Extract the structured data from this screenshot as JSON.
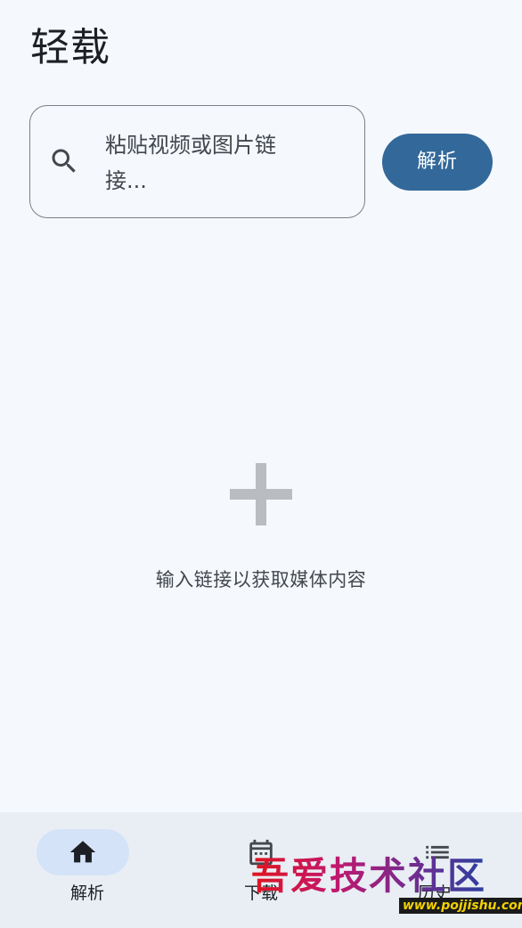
{
  "header": {
    "title": "轻载"
  },
  "search": {
    "placeholder": "粘贴视频或图片链接...",
    "icon": "search-icon"
  },
  "actions": {
    "parse_label": "解析"
  },
  "empty_state": {
    "icon": "add-icon",
    "message": "输入链接以获取媒体内容"
  },
  "bottom_nav": {
    "items": [
      {
        "label": "解析",
        "icon": "home-icon",
        "selected": true
      },
      {
        "label": "下载",
        "icon": "calendar-icon",
        "selected": false
      },
      {
        "label": "历史",
        "icon": "list-icon",
        "selected": false
      }
    ]
  },
  "watermark": {
    "text": "吾爱技术社区",
    "url": "www.pojjishu.com"
  },
  "colors": {
    "background": "#f5f9fd",
    "accent": "#33689a",
    "nav_background": "#e9eef5",
    "nav_indicator": "#d4e3f7"
  }
}
